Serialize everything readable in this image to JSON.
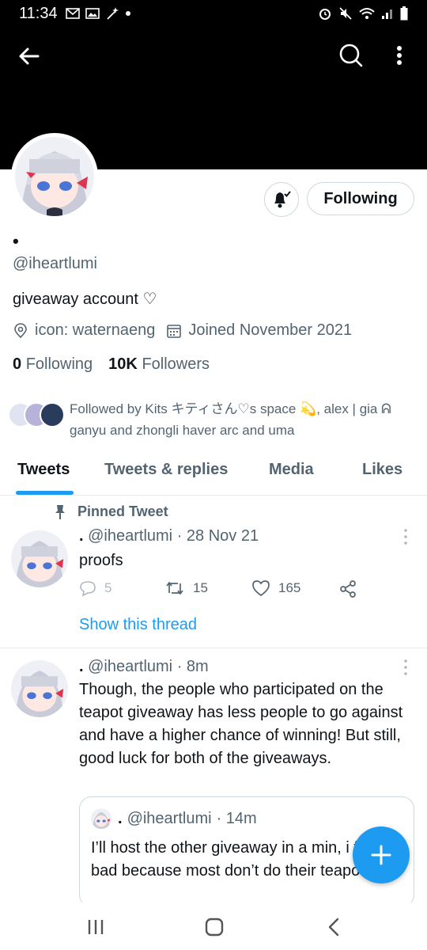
{
  "status_bar": {
    "time": "11:34"
  },
  "profile": {
    "display_name": "•",
    "handle": "@iheartlumi",
    "bio": "giveaway account ♡",
    "location": "icon: waternaeng",
    "joined": "Joined November 2021",
    "following_count": "0",
    "following_label": "Following",
    "followers_count": "10K",
    "followers_label": "Followers",
    "followed_by": "Followed by Kits キティさん♡s space 💫, alex | gia ᕱ ganyu and zhongli haver arc and uma",
    "follow_button_label": "Following"
  },
  "tabs": [
    {
      "label": "Tweets",
      "active": true
    },
    {
      "label": "Tweets & replies",
      "active": false
    },
    {
      "label": "Media",
      "active": false
    },
    {
      "label": "Likes",
      "active": false
    }
  ],
  "pinned_tweet": {
    "pinned_label": "Pinned Tweet",
    "name": ".",
    "handle": "@iheartlumi",
    "time": "· 28 Nov 21",
    "text": "proofs",
    "replies": "5",
    "retweets": "15",
    "likes": "165",
    "show_thread": "Show this thread"
  },
  "tweet2": {
    "name": ".",
    "handle": "@iheartlumi",
    "time": "· 8m",
    "text": "Though, the people who participated on the teapot giveaway has less people to go against and have a higher chance of winning! But still, good luck for both of the giveaways.",
    "quote": {
      "name": ".",
      "handle": "@iheartlumi",
      "time": "· 14m",
      "text": "I’ll host the other giveaway in a min, i feel bad because most don’t do their teapots 😭"
    }
  },
  "colors": {
    "accent": "#1d9bf0",
    "text_primary": "#0f1419",
    "text_secondary": "#536471",
    "banner": "#000000"
  }
}
